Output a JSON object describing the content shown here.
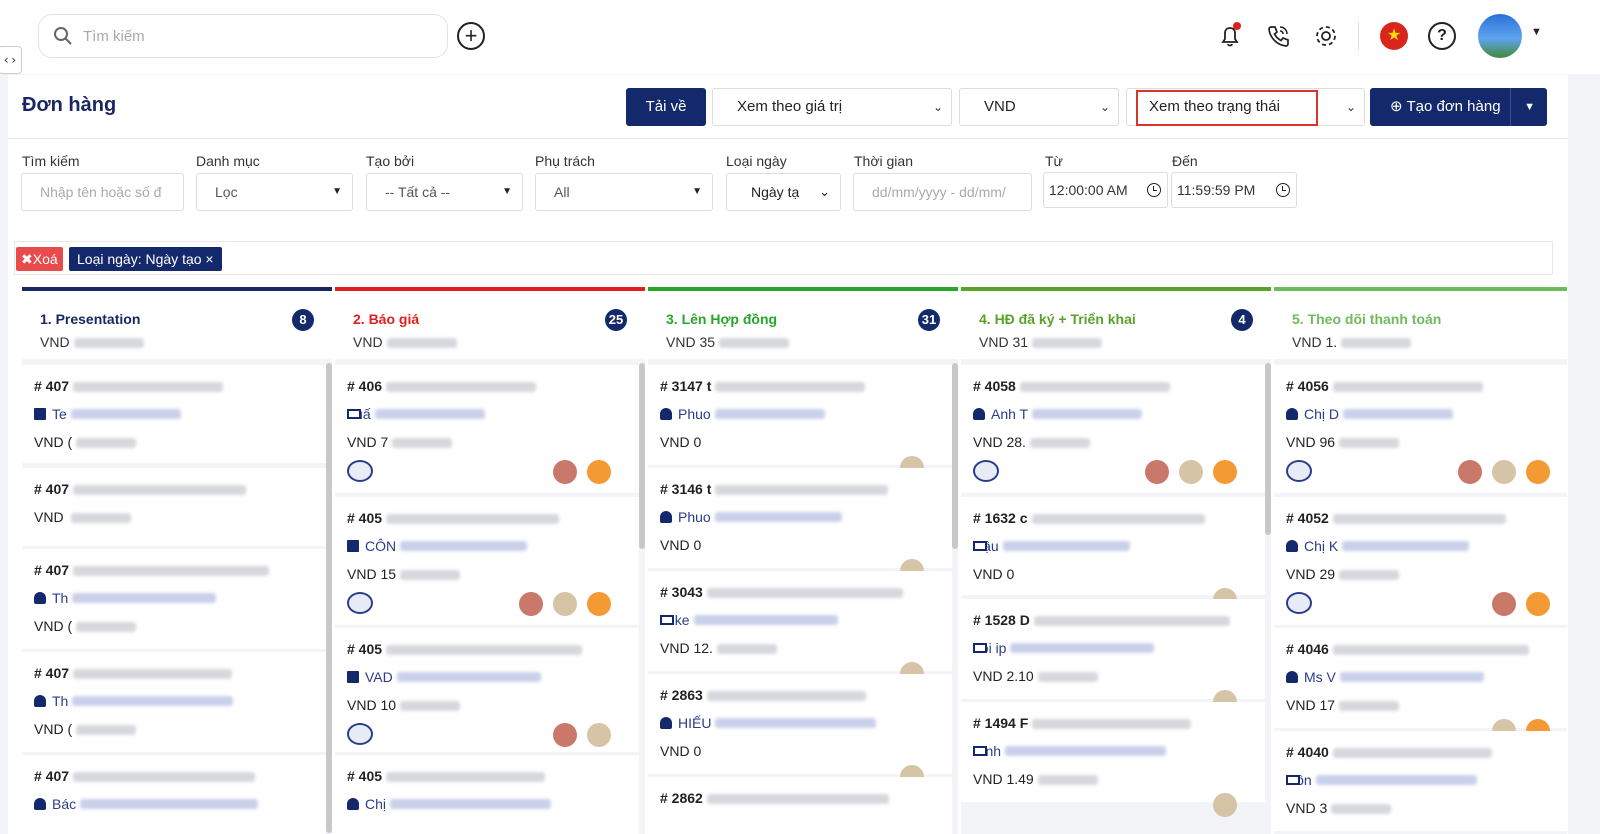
{
  "header": {
    "search_placeholder": "Tìm kiếm",
    "icons": [
      "search-icon",
      "add-icon",
      "bell-icon",
      "phone-icon",
      "gear-icon",
      "vn-flag-icon",
      "help-icon",
      "avatar"
    ],
    "flag_star": "★",
    "help_label": "?",
    "toggle_label": "‹›"
  },
  "toolbar": {
    "title": "Đơn hàng",
    "download_label": "Tải về",
    "view_value": "Xem theo giá trị",
    "currency": "VND",
    "view_status": "Xem theo trạng thái",
    "create_label": "⊕ Tạo đơn hàng"
  },
  "filters": {
    "search_label": "Tìm kiếm",
    "search_placeholder": "Nhập tên hoặc số đ",
    "category_label": "Danh mục",
    "category_value": "Lọc",
    "created_by_label": "Tạo bởi",
    "created_by_value": "-- Tất cả --",
    "owner_label": "Phụ trách",
    "owner_value": "All",
    "date_type_label": "Loại ngày",
    "date_type_value": "Ngày tạ",
    "time_label": "Thời gian",
    "time_placeholder": "dd/mm/yyyy - dd/mm/",
    "from_label": "Từ",
    "from_value": "12:00:00 AM",
    "to_label": "Đến",
    "to_value": "11:59:59 PM"
  },
  "tags": {
    "clear_label": "✖Xoá",
    "active_filter": "Loại ngày: Ngày tạo ×"
  },
  "colors": {
    "navy": "#14296b",
    "presentation": "#1a2763",
    "quote": "#e02020",
    "contract": "#2aa52a",
    "signed": "#5aa32a",
    "payment": "#6fba5a",
    "clear_tag": "#e84b4b",
    "highlight_box": "#d9342b"
  },
  "columns": [
    {
      "title": "1. Presentation",
      "sub": "VND",
      "count": "8",
      "cards": [
        {
          "title": "# 407",
          "person": "Te",
          "pi": "bld",
          "amount": "VND (",
          "badge": false,
          "avatars": []
        },
        {
          "title": "# 407",
          "person": "",
          "pi": "",
          "amount": "VND ",
          "badge": false,
          "avatars": []
        },
        {
          "title": "# 407",
          "person": "Th",
          "pi": "user",
          "amount": "VND (",
          "badge": false,
          "avatars": []
        },
        {
          "title": "# 407",
          "person": "Th",
          "pi": "user",
          "amount": "VND (",
          "badge": false,
          "avatars": []
        },
        {
          "title": "# 407",
          "person": "Bác",
          "pi": "user",
          "amount": "",
          "badge": false,
          "avatars": []
        }
      ]
    },
    {
      "title": "2. Báo giá",
      "sub": "VND",
      "count": "25",
      "cards": [
        {
          "title": "# 406",
          "person": "Tuấ",
          "pi": "card",
          "amount": "VND 7",
          "badge": true,
          "avatars": [
            "brown",
            "orange"
          ]
        },
        {
          "title": "# 405",
          "person": "CÔN",
          "pi": "bld",
          "amount": "VND 15",
          "badge": true,
          "avatars": [
            "brown",
            "man",
            "orange"
          ]
        },
        {
          "title": "# 405",
          "person": "VAD",
          "pi": "bld",
          "amount": "VND 10",
          "badge": true,
          "avatars": [
            "brown",
            "man"
          ]
        },
        {
          "title": "# 405",
          "person": "Chị",
          "pi": "user",
          "amount": "",
          "badge": false,
          "avatars": []
        }
      ]
    },
    {
      "title": "3. Lên Hợp đồng",
      "sub": "VND 35",
      "count": "31",
      "cards": [
        {
          "title": "# 3147 t",
          "person": "Phuo",
          "pi": "user",
          "amount": "VND 0",
          "badge": false,
          "avatars": [
            "man"
          ]
        },
        {
          "title": "# 3146 t",
          "person": "Phuo",
          "pi": "user",
          "amount": "VND 0",
          "badge": false,
          "avatars": [
            "man"
          ]
        },
        {
          "title": "# 3043",
          "person": "Mike",
          "pi": "card",
          "amount": "VND 12.",
          "badge": false,
          "avatars": [
            "man"
          ]
        },
        {
          "title": "# 2863",
          "person": "HIẾU",
          "pi": "user",
          "amount": "VND 0",
          "badge": false,
          "avatars": [
            "man"
          ]
        },
        {
          "title": "# 2862",
          "person": "",
          "pi": "",
          "amount": "",
          "badge": false,
          "avatars": []
        }
      ]
    },
    {
      "title": "4. HĐ đã ký + Triển khai",
      "sub": "VND 31",
      "count": "4",
      "cards": [
        {
          "title": "# 4058",
          "person": "Anh T",
          "pi": "user",
          "amount": "VND 28.",
          "badge": true,
          "avatars": [
            "brown",
            "man",
            "orange"
          ]
        },
        {
          "title": "# 1632 c",
          "person": "Hậu",
          "pi": "card",
          "amount": "VND 0",
          "badge": false,
          "avatars": [
            "man"
          ]
        },
        {
          "title": "# 1528 D",
          "person": "Loi ip",
          "pi": "card",
          "amount": "VND 2.10",
          "badge": false,
          "avatars": [
            "man"
          ]
        },
        {
          "title": "# 1494 F",
          "person": "Binh",
          "pi": "card",
          "amount": "VND 1.49",
          "badge": false,
          "avatars": [
            "man"
          ]
        }
      ]
    },
    {
      "title": "5. Theo dõi thanh toán",
      "sub": "VND 1.",
      "count": "",
      "cards": [
        {
          "title": "# 4056",
          "person": "Chị D",
          "pi": "user",
          "amount": "VND 96",
          "badge": true,
          "avatars": [
            "brown",
            "man",
            "orange"
          ]
        },
        {
          "title": "# 4052",
          "person": "Chị K",
          "pi": "user",
          "amount": "VND 29",
          "badge": true,
          "avatars": [
            "brown",
            "orange"
          ]
        },
        {
          "title": "# 4046",
          "person": "Ms V",
          "pi": "user",
          "amount": "VND 17",
          "badge": false,
          "avatars": [
            "man",
            "orange"
          ]
        },
        {
          "title": "# 4040",
          "person": "Côn",
          "pi": "card",
          "amount": "VND 3",
          "badge": false,
          "avatars": []
        }
      ]
    }
  ]
}
